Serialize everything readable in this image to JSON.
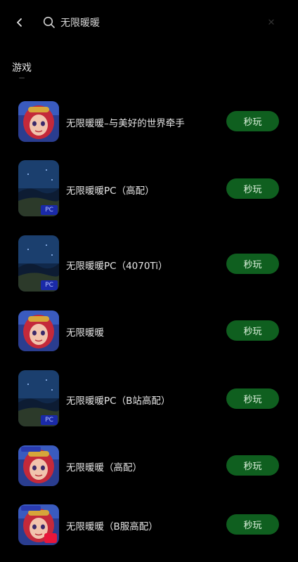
{
  "search": {
    "query": "无限暖暖",
    "back_icon": "chevron-left-icon",
    "search_icon": "search-icon",
    "clear_icon": "close-icon"
  },
  "section": {
    "title": "游戏"
  },
  "accent_colors": {
    "play_button_bg": "#0f5f1f",
    "pc_badge": "#1a2aa8",
    "tv_badge": "#e8163a"
  },
  "games": [
    {
      "name": "无限暖暖–与美好的世界牵手",
      "action": "秒玩",
      "icon": "character-portrait-icon",
      "badge": ""
    },
    {
      "name": "无限暖暖PC（高配）",
      "action": "秒玩",
      "icon": "landscape-night-icon",
      "badge": "PC"
    },
    {
      "name": "无限暖暖PC（4070Ti）",
      "action": "秒玩",
      "icon": "landscape-night-icon",
      "badge": "PC"
    },
    {
      "name": "无限暖暖",
      "action": "秒玩",
      "icon": "character-portrait-icon",
      "badge": ""
    },
    {
      "name": "无限暖暖PC（B站高配）",
      "action": "秒玩",
      "icon": "landscape-night-icon",
      "badge": "PC"
    },
    {
      "name": "无限暖暖（高配）",
      "action": "秒玩",
      "icon": "character-portrait-icon",
      "badge": ""
    },
    {
      "name": "无限暖暖（B服高配）",
      "action": "秒玩",
      "icon": "character-portrait-icon",
      "badge": "tv"
    }
  ]
}
